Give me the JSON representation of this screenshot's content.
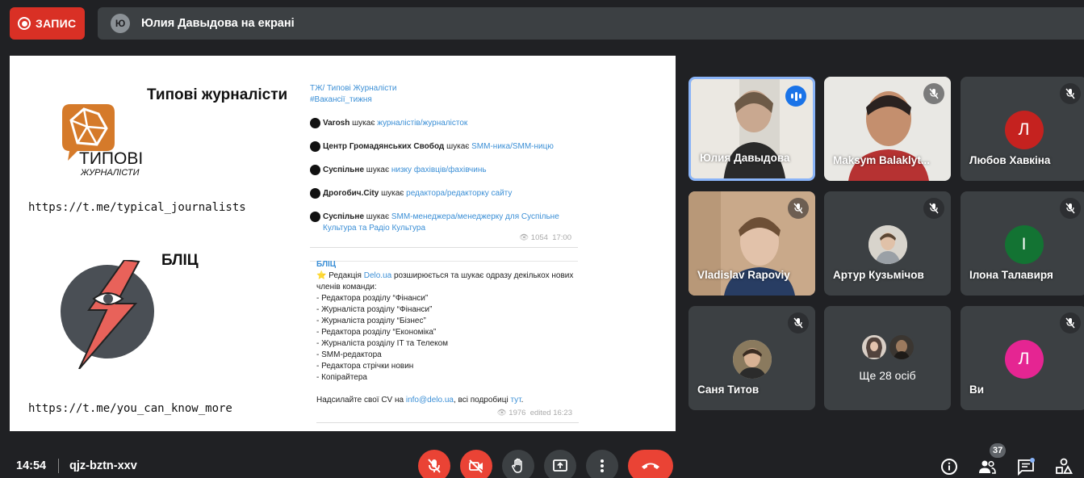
{
  "record": {
    "label": "ЗАПИС",
    "color": "#d93025"
  },
  "presenter": {
    "initial": "Ю",
    "text": "Юлия Давыдова на екрані"
  },
  "slide": {
    "title1": "Типові журналісти",
    "logo1_text1": "ТИПОВІ",
    "logo1_text2": "ЖУРНАЛІСТИ",
    "url1": "https://t.me/typical_journalists",
    "title2": "БЛІЦ",
    "url2": "https://t.me/you_can_know_more",
    "tg1": {
      "channel": "ТЖ/ Типові Журналісти",
      "tag": "#Вакансії_тижня",
      "items": [
        {
          "org": "Varosh",
          "verb": "шукає",
          "link": "журналістів/журналісток"
        },
        {
          "org": "Центр Громадянських Свобод",
          "verb": "шукає",
          "link": "SMM-ника/SMM-ницю"
        },
        {
          "org": "Суспільне",
          "verb": "шукає",
          "link": "низку фахівців/фахівчинь"
        },
        {
          "org": "Дрогобич.City",
          "verb": "шукає",
          "link": "редактора/редакторку сайту"
        },
        {
          "org": "Суспільне",
          "verb": "шукає",
          "link": "SMM-менеджера/менеджерку для Суспільне Культура та Радіо Культура"
        }
      ],
      "views": "1054",
      "time": "17:00"
    },
    "tg2": {
      "channel": "БЛІЦ",
      "intro_prefix": "⭐ Редакція ",
      "intro_link": "Delo.ua",
      "intro_rest": " розширюється та шукає одразу декількох нових членів команди:",
      "items": [
        "- Редактора розділу “Фінанси”",
        "- Журналіста розділу “Фінанси”",
        "- Журналіста розділу “Бізнес”",
        "- Редактора розділу “Економіка”",
        "- Журналіста розділу IT та Телеком",
        "- SMM-редактора",
        "- Редактора стрічки новин",
        "- Копірайтера"
      ],
      "cv_prefix": "Надсилайте свої CV на ",
      "cv_email": "info@delo.ua",
      "cv_mid": ", всі подробиці ",
      "cv_link": "тут",
      "cv_end": ".",
      "views": "1976",
      "edited": "edited 16:23"
    }
  },
  "participants": [
    {
      "name": "Юлия Давыдова",
      "type": "video",
      "speaking": true
    },
    {
      "name": "Maksym Balaklyt...",
      "type": "video",
      "muted": true
    },
    {
      "name": "Любов Хавкіна",
      "type": "avatar",
      "initial": "Л",
      "color": "#c5221f",
      "muted": true
    },
    {
      "name": "Vladislav Rapoviy",
      "type": "video",
      "muted": true
    },
    {
      "name": "Артур Кузьмічов",
      "type": "photo",
      "muted": true
    },
    {
      "name": "Ілона Талавиря",
      "type": "avatar",
      "initial": "І",
      "color": "#137333",
      "muted": true
    },
    {
      "name": "Саня Титов",
      "type": "photo",
      "muted": true
    },
    {
      "name": "Ще 28 осіб",
      "type": "more"
    },
    {
      "name": "Ви",
      "type": "avatar",
      "initial": "Л",
      "color": "#e52592",
      "muted": true
    }
  ],
  "bottom": {
    "time": "14:54",
    "meeting_code": "qjz-bztn-xxv",
    "participants_count": "37"
  }
}
